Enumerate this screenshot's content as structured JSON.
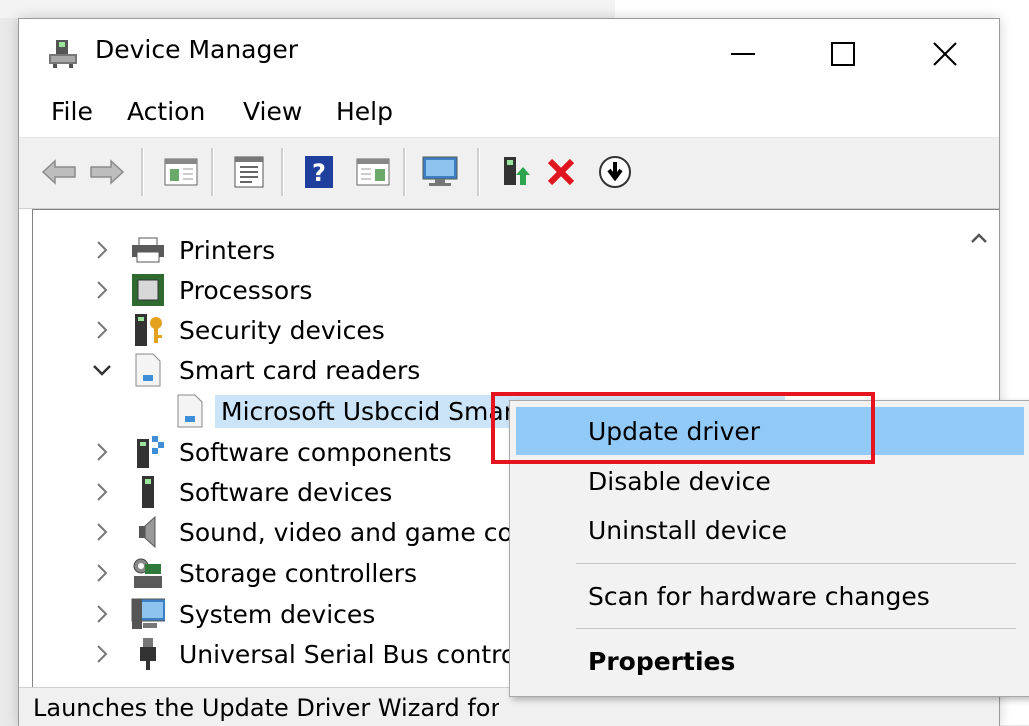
{
  "window": {
    "title": "Device Manager"
  },
  "menu": {
    "items": [
      "File",
      "Action",
      "View",
      "Help"
    ]
  },
  "toolbar": {
    "icons": [
      "back-arrow-icon",
      "forward-arrow-icon",
      "show-hide-console-tree-icon",
      "properties-icon",
      "help-icon",
      "show-action-pane-icon",
      "scan-hardware-changes-icon",
      "update-driver-icon",
      "uninstall-device-icon",
      "enable-device-icon"
    ]
  },
  "tree": {
    "items": [
      {
        "label": "Printers",
        "expanded": false,
        "icon": "printer-icon"
      },
      {
        "label": "Processors",
        "expanded": false,
        "icon": "processor-icon"
      },
      {
        "label": "Security devices",
        "expanded": false,
        "icon": "security-device-icon"
      },
      {
        "label": "Smart card readers",
        "expanded": true,
        "icon": "smart-card-reader-icon"
      },
      {
        "label": "Microsoft Usbccid Smartcard Reader (WUDF)",
        "child": true,
        "selected": true,
        "icon": "smart-card-reader-icon"
      },
      {
        "label": "Software components",
        "expanded": false,
        "icon": "software-component-icon"
      },
      {
        "label": "Software devices",
        "expanded": false,
        "icon": "software-device-icon"
      },
      {
        "label": "Sound, video and game controllers",
        "expanded": false,
        "icon": "speaker-icon"
      },
      {
        "label": "Storage controllers",
        "expanded": false,
        "icon": "storage-controller-icon"
      },
      {
        "label": "System devices",
        "expanded": false,
        "icon": "system-device-icon"
      },
      {
        "label": "Universal Serial Bus controllers",
        "expanded": false,
        "icon": "usb-icon"
      }
    ]
  },
  "context_menu": {
    "items": [
      {
        "label": "Update driver",
        "hover": true
      },
      {
        "label": "Disable device"
      },
      {
        "label": "Uninstall device"
      },
      {
        "label": "Scan for hardware changes"
      },
      {
        "label": "Properties",
        "bold": true
      }
    ]
  },
  "status": {
    "text": "Launches the Update Driver Wizard for the selected device."
  },
  "colors": {
    "selection": "#cce4f7",
    "menu_hover": "#91c9f7",
    "highlight_border": "#e6141e"
  }
}
